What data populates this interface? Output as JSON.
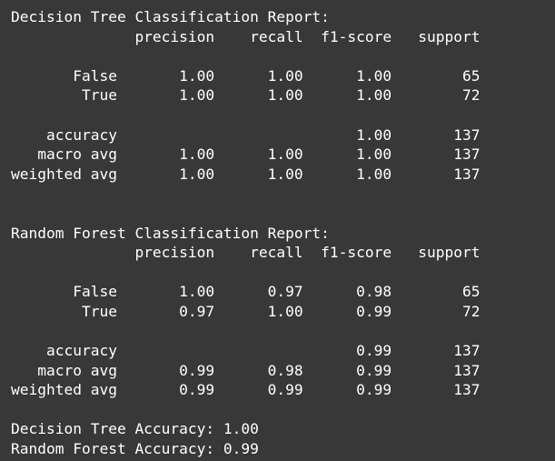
{
  "output": {
    "lines": [
      "Decision Tree Classification Report:",
      "              precision    recall  f1-score   support",
      "",
      "       False       1.00      1.00      1.00        65",
      "        True       1.00      1.00      1.00        72",
      "",
      "    accuracy                           1.00       137",
      "   macro avg       1.00      1.00      1.00       137",
      "weighted avg       1.00      1.00      1.00       137",
      "",
      "",
      "Random Forest Classification Report:",
      "              precision    recall  f1-score   support",
      "",
      "       False       1.00      0.97      0.98        65",
      "        True       0.97      1.00      0.99        72",
      "",
      "    accuracy                           0.99       137",
      "   macro avg       0.99      0.98      0.99       137",
      "weighted avg       0.99      0.99      0.99       137",
      "",
      "Decision Tree Accuracy: 1.00",
      "Random Forest Accuracy: 0.99"
    ]
  }
}
